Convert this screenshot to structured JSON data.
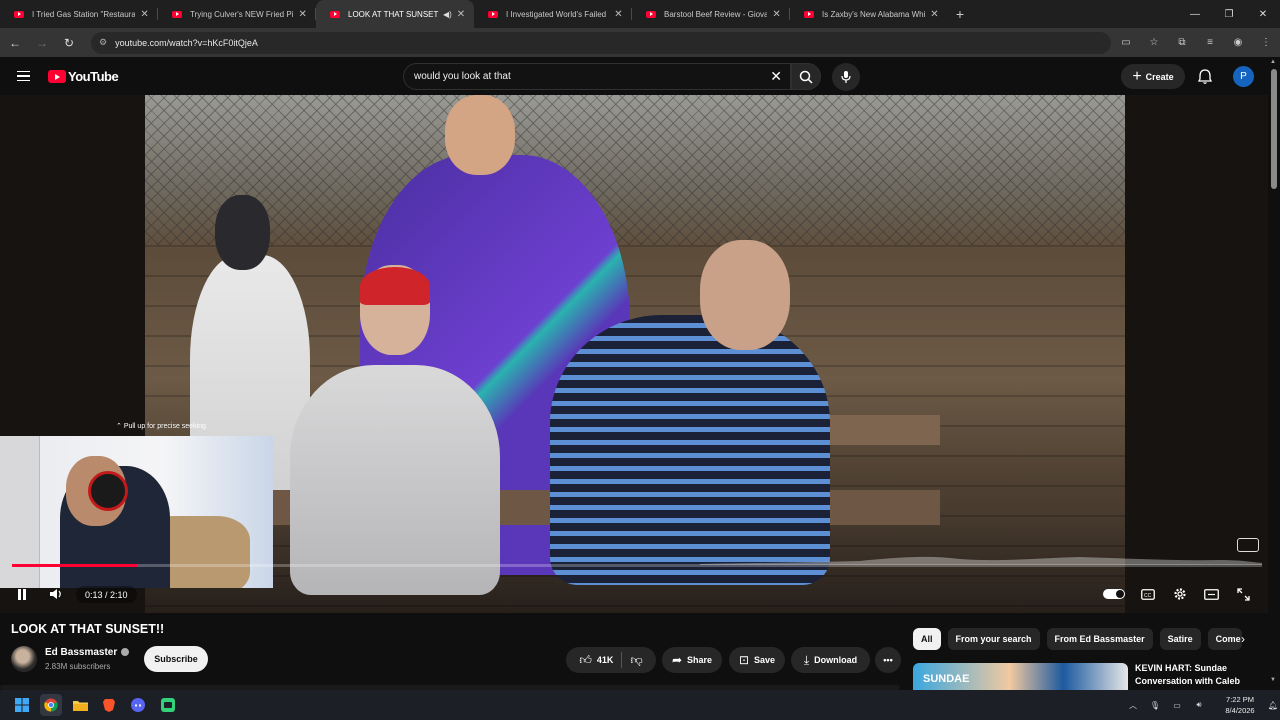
{
  "browser": {
    "tabs": [
      {
        "title": "I Tried Gas Station \"Restaurants",
        "active": false
      },
      {
        "title": "Trying Culver's NEW Fried Pickle",
        "active": false
      },
      {
        "title": "LOOK AT THAT SUNSET!! - Y",
        "active": true
      },
      {
        "title": "I Investigated World's Failed La",
        "active": false
      },
      {
        "title": "Barstool Beef Review - Giovanni",
        "active": false
      },
      {
        "title": "Is Zaxby's New Alabama White",
        "active": false
      }
    ],
    "url": "youtube.com/watch?v=hKcF0itQjeA"
  },
  "youtube": {
    "logo_text": "YouTube",
    "search_query": "would you look at that",
    "create_label": "Create",
    "avatar_letter": "P"
  },
  "player": {
    "seek_hint": "Pull up for precise seeking",
    "current_time": "0:13",
    "duration": "2:10",
    "time_display": "0:13 / 2:10",
    "progress_fraction": 0.1
  },
  "video": {
    "title": "LOOK AT THAT SUNSET!!",
    "channel_name": "Ed Bassmaster",
    "subscribers": "2.83M subscribers",
    "subscribe_label": "Subscribe",
    "likes": "41K",
    "share_label": "Share",
    "save_label": "Save",
    "download_label": "Download"
  },
  "sidebar": {
    "chips": [
      "All",
      "From your search",
      "From Ed Bassmaster",
      "Satire",
      "Come"
    ],
    "recommendation": {
      "thumb_text": "SUNDAE",
      "title": "KEVIN HART: Sundae Conversation with Caleb"
    }
  },
  "taskbar": {
    "time": "7:22 PM",
    "date": "8/4/2026"
  },
  "colors": {
    "youtube_red": "#ff0033",
    "background": "#0f0f0f",
    "chip_bg": "#272727"
  }
}
